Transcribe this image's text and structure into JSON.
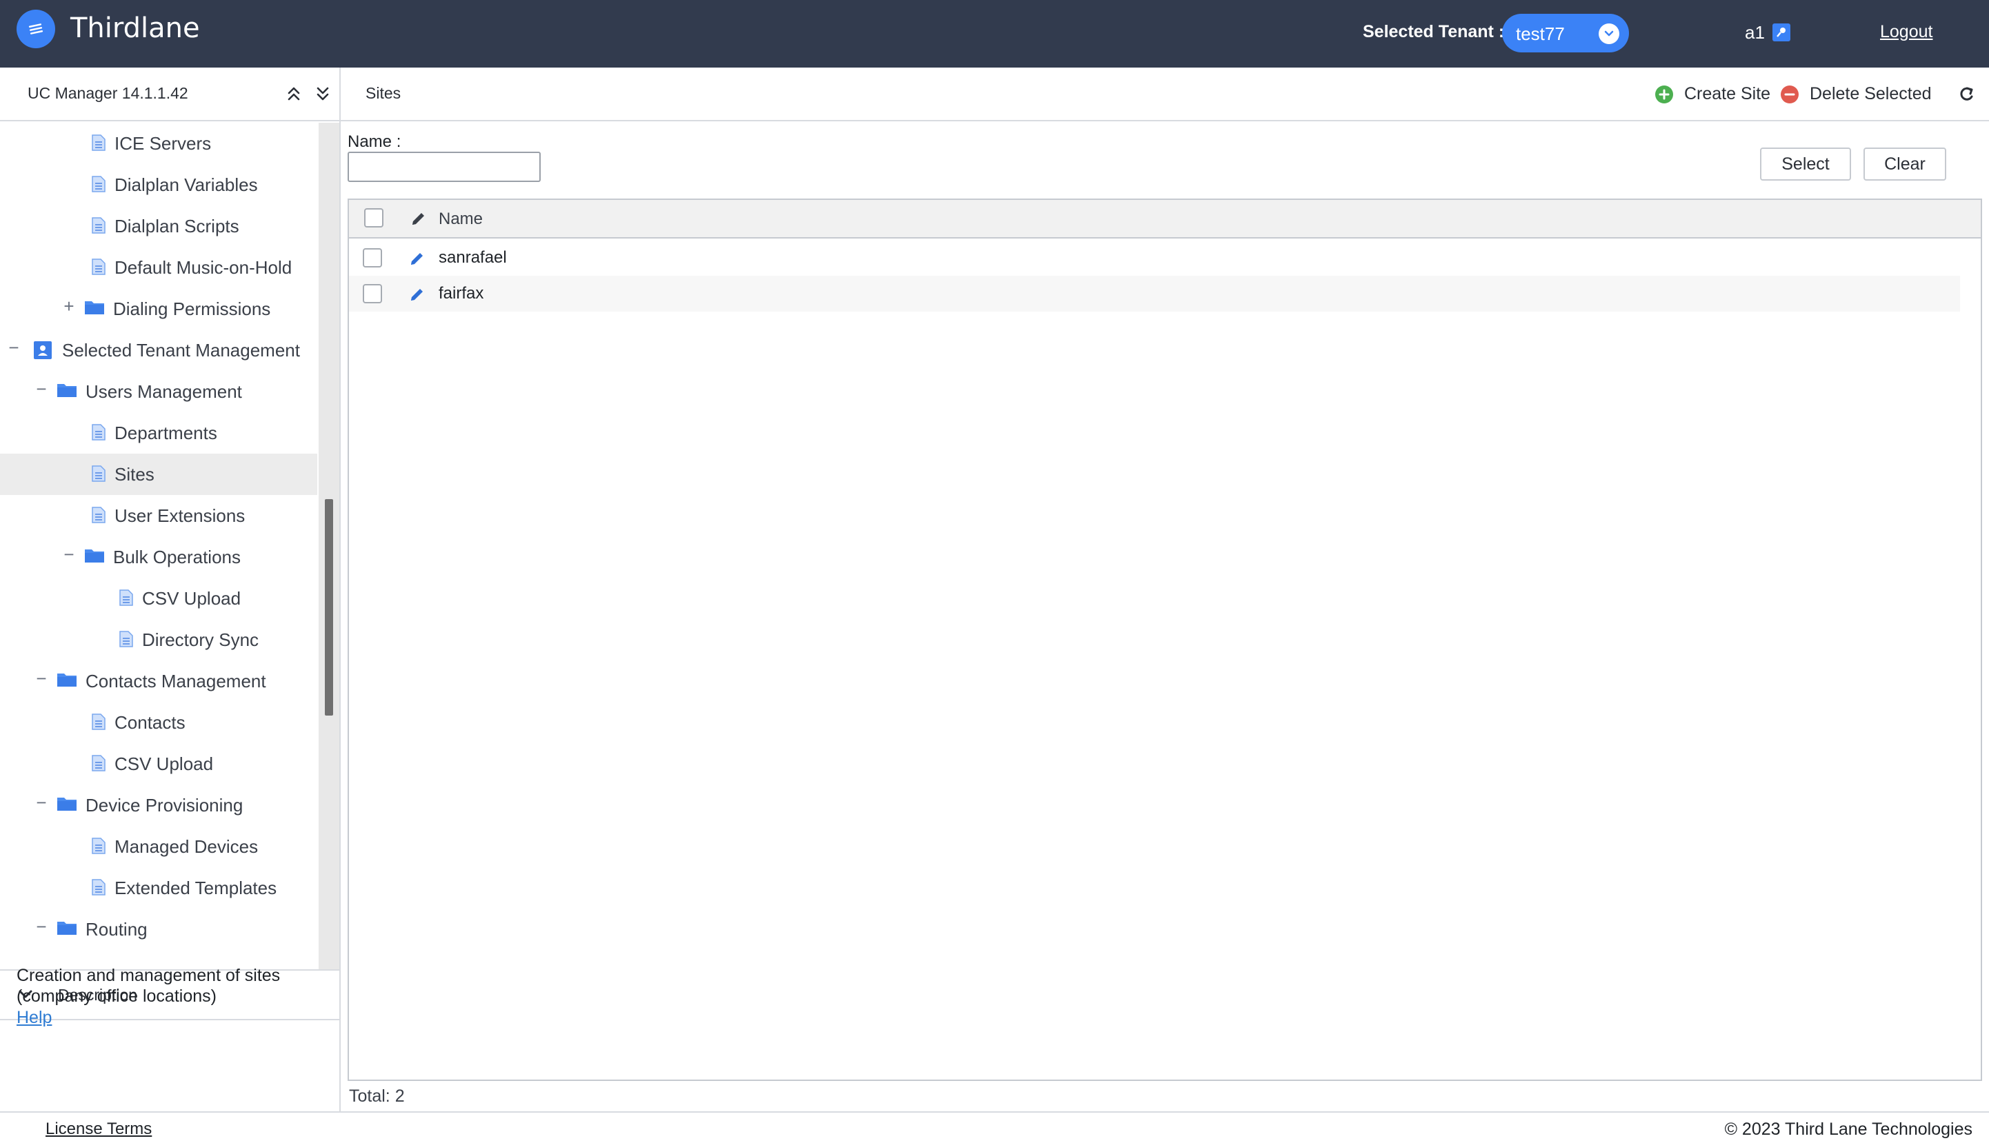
{
  "header": {
    "app_title": "Thirdlane",
    "tenant_label": "Selected Tenant :",
    "tenant_value": "test77",
    "user_name": "a1",
    "logout_label": "Logout"
  },
  "sidebar": {
    "title": "UC Manager 14.1.1.42",
    "tree": [
      {
        "label": "ICE Servers",
        "type": "page",
        "level": 2
      },
      {
        "label": "Dialplan Variables",
        "type": "page",
        "level": 2
      },
      {
        "label": "Dialplan Scripts",
        "type": "page",
        "level": 2
      },
      {
        "label": "Default Music-on-Hold",
        "type": "page",
        "level": 2
      },
      {
        "label": "Dialing Permissions",
        "type": "folder",
        "level": 2,
        "toggle": "+"
      },
      {
        "label": "Selected Tenant Management",
        "type": "tenant",
        "level": 0,
        "toggle": "−"
      },
      {
        "label": "Users Management",
        "type": "folder",
        "level": 1,
        "toggle": "−"
      },
      {
        "label": "Departments",
        "type": "page",
        "level": 2
      },
      {
        "label": "Sites",
        "type": "page",
        "level": 2,
        "selected": true
      },
      {
        "label": "User Extensions",
        "type": "page",
        "level": 2
      },
      {
        "label": "Bulk Operations",
        "type": "folder",
        "level": 2,
        "toggle": "−"
      },
      {
        "label": "CSV Upload",
        "type": "page",
        "level": 3
      },
      {
        "label": "Directory Sync",
        "type": "page",
        "level": 3
      },
      {
        "label": "Contacts Management",
        "type": "folder",
        "level": 1,
        "toggle": "−"
      },
      {
        "label": "Contacts",
        "type": "page",
        "level": 2
      },
      {
        "label": "CSV Upload",
        "type": "page",
        "level": 2
      },
      {
        "label": "Device Provisioning",
        "type": "folder",
        "level": 1,
        "toggle": "−"
      },
      {
        "label": "Managed Devices",
        "type": "page",
        "level": 2
      },
      {
        "label": "Extended Templates",
        "type": "page",
        "level": 2
      },
      {
        "label": "Routing",
        "type": "folder",
        "level": 1,
        "toggle": "−"
      }
    ],
    "description": {
      "title": "Description",
      "text": "Creation and management of sites (company office locations)",
      "help_label": "Help"
    }
  },
  "main": {
    "breadcrumb": "Sites",
    "create_label": "Create Site",
    "delete_label": "Delete Selected",
    "filter": {
      "label": "Name :",
      "value": "",
      "select_label": "Select",
      "clear_label": "Clear"
    },
    "table": {
      "columns": [
        "Name"
      ],
      "rows": [
        {
          "name": "sanrafael"
        },
        {
          "name": "fairfax"
        }
      ]
    },
    "total": "Total: 2"
  },
  "footer": {
    "license_label": "License Terms",
    "copyright": "© 2023 Third Lane Technologies"
  },
  "colors": {
    "topbar": "#323b4e",
    "accent": "#3b82f6",
    "create": "#4caf50",
    "delete": "#e05a4f"
  }
}
